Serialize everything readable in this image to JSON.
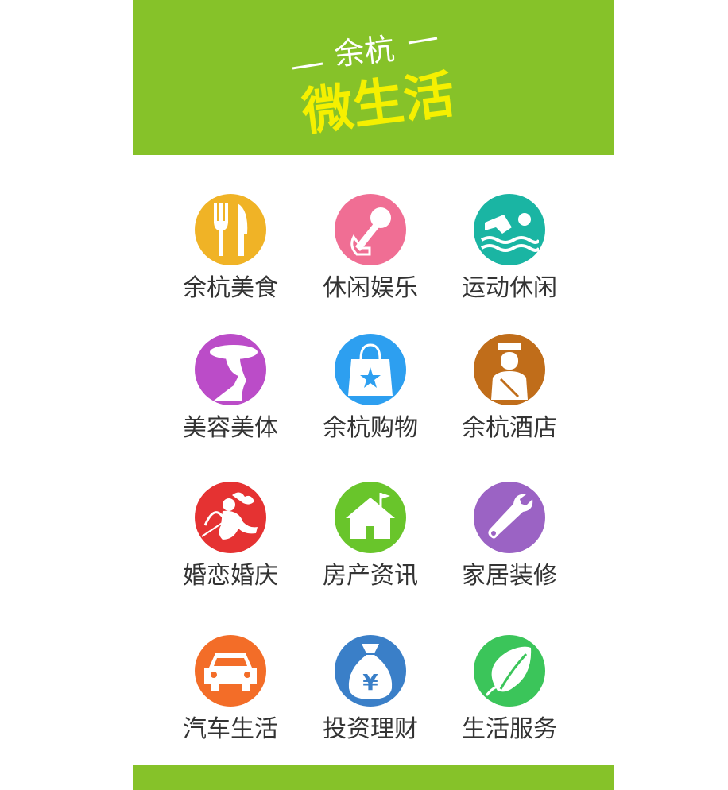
{
  "header": {
    "subtitle": "余杭",
    "title": "微生活",
    "background": "#86c229",
    "title_color": "#f5f000"
  },
  "menu": [
    {
      "label": "余杭美食",
      "icon": "fork-knife-icon",
      "color": "#f0b326"
    },
    {
      "label": "休闲娱乐",
      "icon": "microphone-icon",
      "color": "#f06e94"
    },
    {
      "label": "运动休闲",
      "icon": "swimmer-icon",
      "color": "#1ab5a3"
    },
    {
      "label": "美容美体",
      "icon": "lady-hat-icon",
      "color": "#bb4cc8"
    },
    {
      "label": "余杭购物",
      "icon": "shopping-bag-icon",
      "color": "#2d9ff0"
    },
    {
      "label": "余杭酒店",
      "icon": "hotel-porter-icon",
      "color": "#c06d1a"
    },
    {
      "label": "婚恋婚庆",
      "icon": "cupid-icon",
      "color": "#e53232"
    },
    {
      "label": "房产资讯",
      "icon": "house-icon",
      "color": "#69c52b"
    },
    {
      "label": "家居装修",
      "icon": "wrench-icon",
      "color": "#9b63c4"
    },
    {
      "label": "汽车生活",
      "icon": "car-icon",
      "color": "#f36d28"
    },
    {
      "label": "投资理财",
      "icon": "money-bag-icon",
      "color": "#3a7fc8"
    },
    {
      "label": "生活服务",
      "icon": "leaf-icon",
      "color": "#3bc55a"
    }
  ],
  "footer": {
    "background": "#86c229"
  }
}
